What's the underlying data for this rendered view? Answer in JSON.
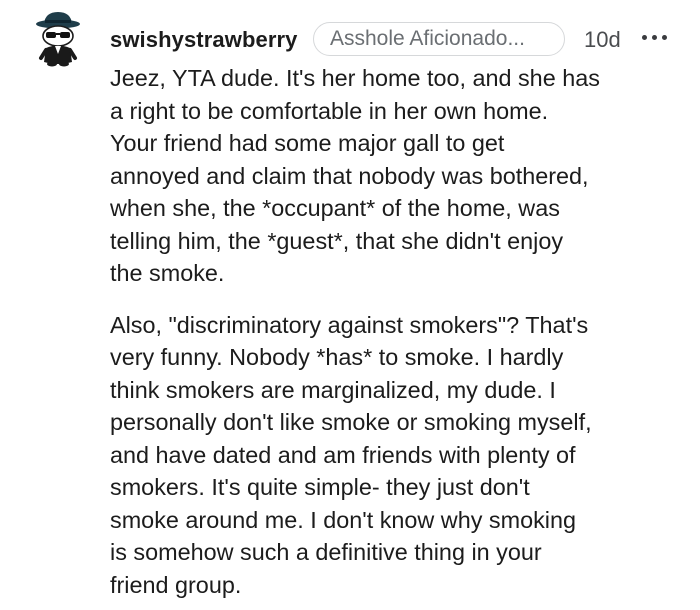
{
  "comment": {
    "username": "swishystrawberry",
    "flair": "Asshole Aficionado...",
    "timestamp": "10d",
    "more_icon": "more-horizontal-icon",
    "avatar_icon": "snoo-avatar-icon",
    "paragraphs": [
      "Jeez, YTA dude. It's her home too, and she has\na right to be comfortable in her own home.\nYour friend had some major gall to get\nannoyed and claim that nobody was bothered,\nwhen she, the *occupant* of the home, was\ntelling him, the *guest*, that she didn't enjoy\nthe smoke.",
      "Also, \"discriminatory against smokers\"? That's\nvery funny. Nobody *has* to smoke. I hardly\nthink smokers are marginalized, my dude. I\npersonally don't like smoke or smoking myself,\nand have dated and am friends with plenty of\nsmokers. It's quite simple- they just don't\nsmoke around me. I don't know why smoking\nis somehow such a definitive thing in your\nfriend group."
    ]
  },
  "colors": {
    "text": "#1c1c1c",
    "meta": "#6b6f73",
    "flair_border": "#d6d8da",
    "background": "#ffffff"
  }
}
